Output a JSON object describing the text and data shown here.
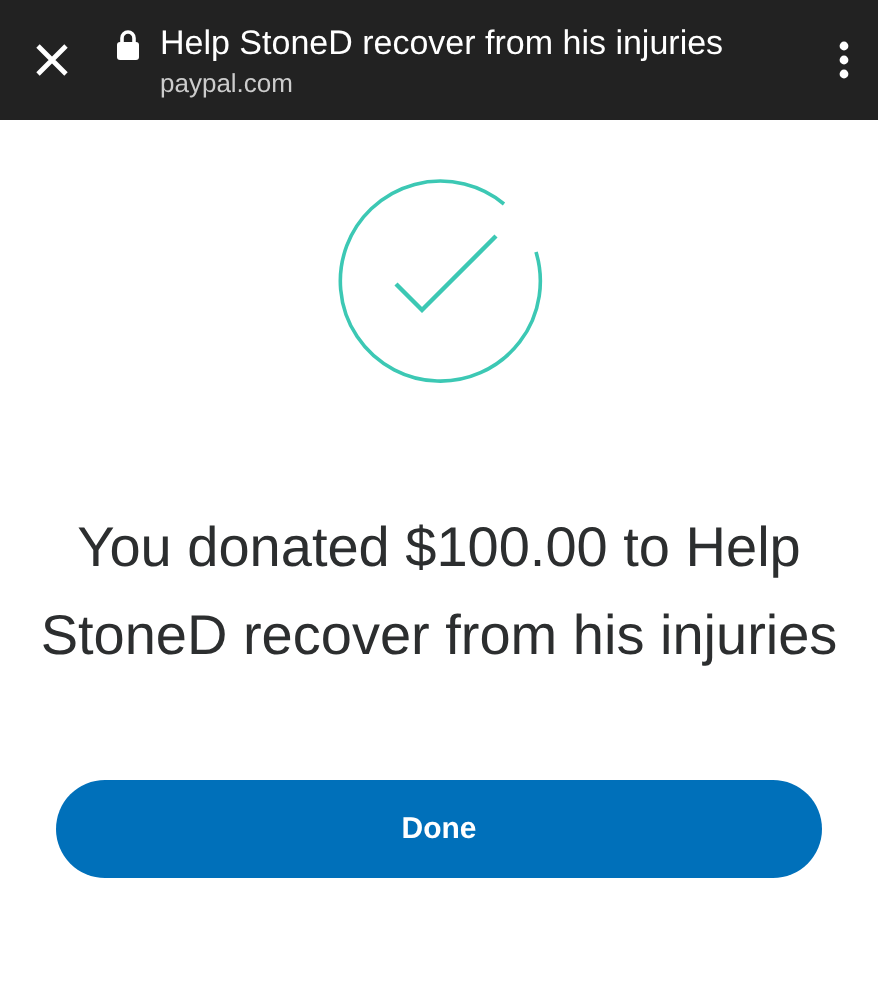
{
  "browser_bar": {
    "title": "Help StoneD recover from his injuries",
    "url": "paypal.com"
  },
  "confirmation": {
    "message": "You donated $100.00 to Help StoneD recover from his injuries"
  },
  "buttons": [
    "Done"
  ]
}
